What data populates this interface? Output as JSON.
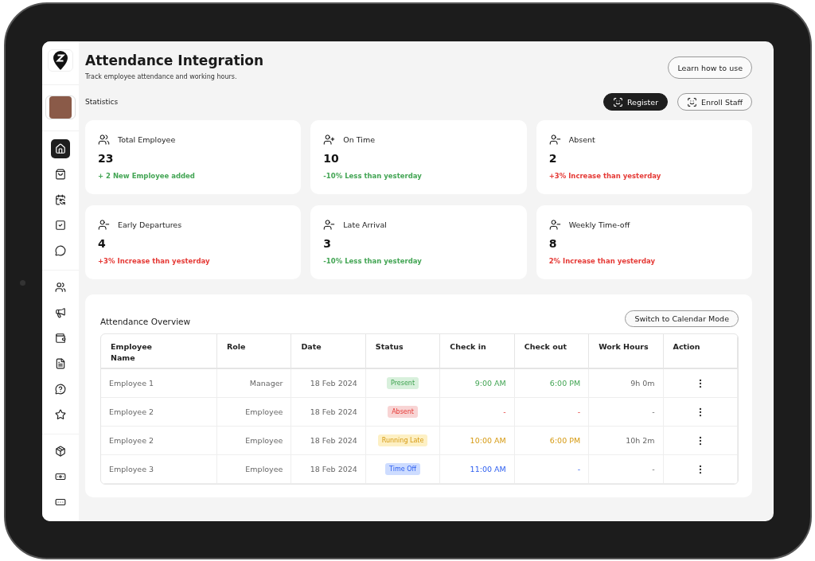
{
  "sidebar": {
    "groups": [
      [
        {
          "selected": true
        },
        {
          "selected": false
        },
        {
          "selected": false
        },
        {
          "selected": false
        },
        {
          "selected": false
        }
      ],
      [
        {
          "selected": false
        },
        {
          "selected": false
        },
        {
          "selected": false
        },
        {
          "selected": false
        },
        {
          "selected": false
        },
        {
          "selected": false
        }
      ],
      [
        {
          "selected": false
        },
        {
          "selected": false
        },
        {
          "selected": false
        }
      ]
    ]
  },
  "header": {
    "title": "Attendance Integration",
    "subtitle": "Track employee attendance and working hours.",
    "help_button": "Learn how to use"
  },
  "statistics": {
    "heading": "Statistics",
    "actions": [
      {
        "label": "Register",
        "primary": true
      },
      {
        "label": "Enroll Staff",
        "primary": false
      }
    ],
    "cards": [
      {
        "kind": "users",
        "label": "Total Employee",
        "value": "23",
        "note": "+ 2 New Employee added",
        "color": "#43a554"
      },
      {
        "kind": "user-plus",
        "label": "On Time",
        "value": "10",
        "note": "-10% Less than yesterday",
        "color": "#43a554"
      },
      {
        "kind": "user-minus",
        "label": "Absent",
        "value": "2",
        "note": "+3% Increase than yesterday",
        "color": "#e53935"
      },
      {
        "kind": "user-minus",
        "label": "Early Departures",
        "value": "4",
        "note": "+3% Increase than yesterday",
        "color": "#e53935"
      },
      {
        "kind": "user-minus",
        "label": "Late Arrival",
        "value": "3",
        "note": "-10% Less than yesterday",
        "color": "#43a554"
      },
      {
        "kind": "user-minus",
        "label": "Weekly Time-off",
        "value": "8",
        "note": "2% Increase than yesterday",
        "color": "#e53935"
      }
    ]
  },
  "overview": {
    "title": "Attendance Overview",
    "switch_button": "Switch to Calendar Mode",
    "columns": [
      "Employee Name",
      "Role",
      "Date",
      "Status",
      "Check in",
      "Check out",
      "Work Hours",
      "Action"
    ],
    "rows": [
      {
        "name": "Employee 1",
        "role": "Manager",
        "date": "18 Feb 2024",
        "status": {
          "label": "Present",
          "kind": "present"
        },
        "check_in": "9:00 AM",
        "check_out": "6:00 PM",
        "work_hours": "9h 0m"
      },
      {
        "name": "Employee 2",
        "role": "Employee",
        "date": "18 Feb 2024",
        "status": {
          "label": "Absent",
          "kind": "absent"
        },
        "check_in": "-",
        "check_out": "-",
        "work_hours": "-"
      },
      {
        "name": "Employee 2",
        "role": "Employee",
        "date": "18 Feb 2024",
        "status": {
          "label": "Running Late",
          "kind": "late"
        },
        "check_in": "10:00 AM",
        "check_out": "6:00 PM",
        "work_hours": "10h 2m"
      },
      {
        "name": "Employee 3",
        "role": "Employee",
        "date": "18 Feb 2024",
        "status": {
          "label": "Time Off",
          "kind": "timeoff"
        },
        "check_in": "11:00 AM",
        "check_out": "-",
        "work_hours": "-"
      }
    ]
  }
}
